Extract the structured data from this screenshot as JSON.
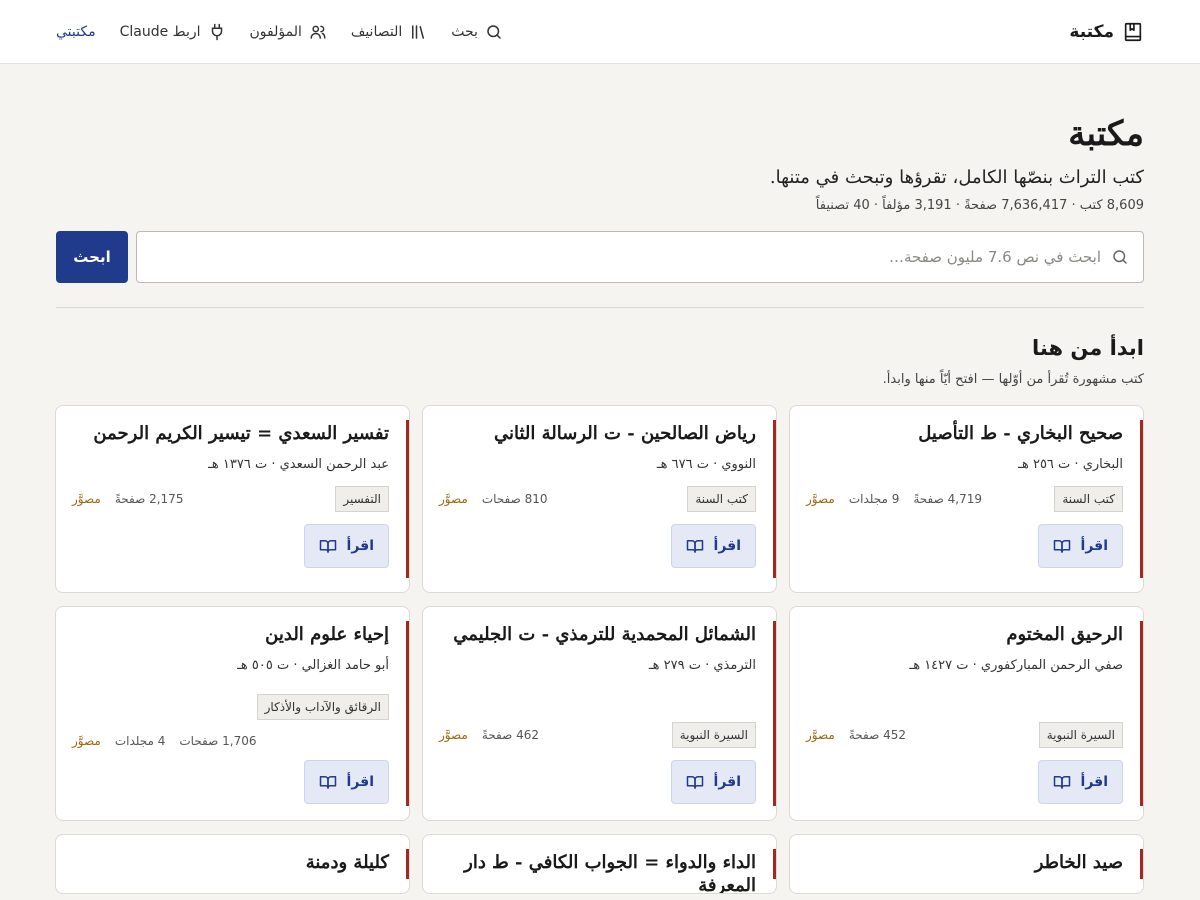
{
  "header": {
    "brand": "مكتبة",
    "nav": [
      {
        "label": "بحث",
        "icon": "search-icon"
      },
      {
        "label": "التصانيف",
        "icon": "library-icon"
      },
      {
        "label": "المؤلفون",
        "icon": "users-icon"
      },
      {
        "label": "اربط Claude",
        "icon": "plug-icon"
      },
      {
        "label": "مكتبتي",
        "icon": ""
      }
    ]
  },
  "hero": {
    "title": "مكتبة",
    "subtitle": "كتب التراث بنصّها الكامل، تقرؤها وتبحث في متنها.",
    "stats": "8,609 كتب · 7,636,417 صفحةً · 3,191 مؤلفاً · 40 تصنيفاً",
    "search_placeholder": "ابحث في نص 7.6 مليون صفحة…",
    "search_button": "ابحث"
  },
  "section": {
    "title": "ابدأ من هنا",
    "subtitle": "كتب مشهورة تُقرأ من أوّلها — افتح أيّاً منها وابدأ."
  },
  "books": [
    {
      "title": "صحيح البخاري - ط التأصيل",
      "author": "البخاري · ت ٢٥٦ هـ",
      "category": "كتب السنة",
      "pages": "4,719 صفحةً",
      "volumes": "9 مجلدات",
      "scanned": "مصوَّر",
      "read": "اقرأ"
    },
    {
      "title": "رياض الصالحين - ت الرسالة الثاني",
      "author": "النووي · ت ٦٧٦ هـ",
      "category": "كتب السنة",
      "pages": "810 صفحات",
      "volumes": "",
      "scanned": "مصوَّر",
      "read": "اقرأ"
    },
    {
      "title": "تفسير السعدي = تيسير الكريم الرحمن",
      "author": "عبد الرحمن السعدي · ت ١٣٧٦ هـ",
      "category": "التفسير",
      "pages": "2,175 صفحةً",
      "volumes": "",
      "scanned": "مصوَّر",
      "read": "اقرأ"
    },
    {
      "title": "الرحيق المختوم",
      "author": "صفي الرحمن المباركفوري · ت ١٤٢٧ هـ",
      "category": "السيرة النبوية",
      "pages": "452 صفحةً",
      "volumes": "",
      "scanned": "مصوَّر",
      "read": "اقرأ"
    },
    {
      "title": "الشمائل المحمدية للترمذي - ت الجليمي",
      "author": "الترمذي · ت ٢٧٩ هـ",
      "category": "السيرة النبوية",
      "pages": "462 صفحةً",
      "volumes": "",
      "scanned": "مصوَّر",
      "read": "اقرأ"
    },
    {
      "title": "إحياء علوم الدين",
      "author": "أبو حامد الغزالي · ت ٥٠٥ هـ",
      "category": "الرقائق والآداب والأذكار",
      "pages": "1,706 صفحات",
      "volumes": "4 مجلدات",
      "scanned": "مصوَّر",
      "read": "اقرأ"
    },
    {
      "title": "صيد الخاطر"
    },
    {
      "title": "الداء والدواء = الجواب الكافي - ط دار المعرفة"
    },
    {
      "title": "كليلة ودمنة"
    }
  ]
}
